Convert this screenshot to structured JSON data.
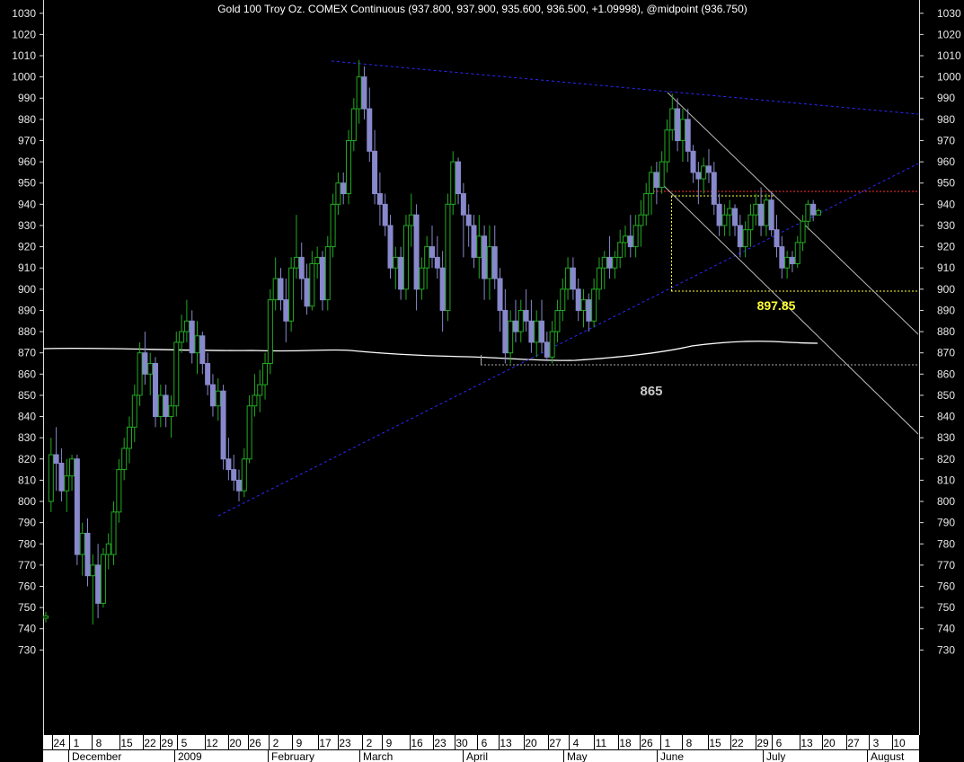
{
  "chart_data": {
    "type": "candlestick",
    "title": "Gold 100 Troy Oz. COMEX Continuous (937.800, 937.900, 935.600, 936.500, +1.09998), @midpoint (936.750)",
    "y_ticks": [
      1030,
      1020,
      1010,
      1000,
      990,
      980,
      970,
      960,
      950,
      940,
      930,
      920,
      910,
      900,
      890,
      880,
      870,
      860,
      850,
      840,
      830,
      820,
      810,
      800,
      790,
      780,
      770,
      760,
      750,
      740,
      730
    ],
    "ylim": [
      723,
      1035
    ],
    "day_labels": [
      "24",
      "1",
      "8",
      "15",
      "22",
      "29",
      "5",
      "12",
      "20",
      "26",
      "2",
      "9",
      "17",
      "23",
      "2",
      "9",
      "16",
      "23",
      "30",
      "6",
      "13",
      "20",
      "27",
      "4",
      "11",
      "18",
      "26",
      "1",
      "8",
      "15",
      "22",
      "29",
      "6",
      "13",
      "20",
      "27",
      "3",
      "10"
    ],
    "month_labels": [
      "December",
      "2009",
      "February",
      "March",
      "April",
      "May",
      "June",
      "July",
      "August"
    ],
    "annotations": [
      {
        "text": "897.85",
        "color": "#ffff33"
      },
      {
        "text": "865",
        "color": "#c8c8c8"
      }
    ],
    "colors": {
      "up": "#22aa22",
      "down": "#8888cc",
      "trend": "#2a2aff",
      "resistance": "#ff3030",
      "support_box": "#ffff33",
      "ma": "#ffffff",
      "channel": "#bbbbbb"
    },
    "candles": [
      {
        "o": 745,
        "h": 748,
        "l": 743,
        "c": 746
      },
      {
        "o": 800,
        "h": 830,
        "l": 795,
        "c": 822
      },
      {
        "o": 822,
        "h": 835,
        "l": 805,
        "c": 818
      },
      {
        "o": 818,
        "h": 825,
        "l": 800,
        "c": 805
      },
      {
        "o": 805,
        "h": 820,
        "l": 795,
        "c": 812
      },
      {
        "o": 812,
        "h": 822,
        "l": 805,
        "c": 820
      },
      {
        "o": 820,
        "h": 822,
        "l": 770,
        "c": 775
      },
      {
        "o": 775,
        "h": 790,
        "l": 765,
        "c": 785
      },
      {
        "o": 785,
        "h": 792,
        "l": 760,
        "c": 765
      },
      {
        "o": 765,
        "h": 775,
        "l": 742,
        "c": 770
      },
      {
        "o": 770,
        "h": 780,
        "l": 745,
        "c": 752
      },
      {
        "o": 752,
        "h": 778,
        "l": 750,
        "c": 775
      },
      {
        "o": 775,
        "h": 785,
        "l": 768,
        "c": 780
      },
      {
        "o": 775,
        "h": 800,
        "l": 770,
        "c": 795
      },
      {
        "o": 795,
        "h": 820,
        "l": 790,
        "c": 815
      },
      {
        "o": 815,
        "h": 830,
        "l": 810,
        "c": 825
      },
      {
        "o": 825,
        "h": 840,
        "l": 818,
        "c": 835
      },
      {
        "o": 835,
        "h": 855,
        "l": 828,
        "c": 850
      },
      {
        "o": 850,
        "h": 875,
        "l": 845,
        "c": 870
      },
      {
        "o": 870,
        "h": 880,
        "l": 855,
        "c": 860
      },
      {
        "o": 860,
        "h": 870,
        "l": 850,
        "c": 865
      },
      {
        "o": 865,
        "h": 868,
        "l": 835,
        "c": 840
      },
      {
        "o": 840,
        "h": 855,
        "l": 835,
        "c": 850
      },
      {
        "o": 850,
        "h": 855,
        "l": 835,
        "c": 840
      },
      {
        "o": 840,
        "h": 850,
        "l": 830,
        "c": 845
      },
      {
        "o": 845,
        "h": 880,
        "l": 840,
        "c": 875
      },
      {
        "o": 875,
        "h": 888,
        "l": 870,
        "c": 880
      },
      {
        "o": 880,
        "h": 895,
        "l": 875,
        "c": 885
      },
      {
        "o": 885,
        "h": 890,
        "l": 865,
        "c": 870
      },
      {
        "o": 870,
        "h": 885,
        "l": 860,
        "c": 878
      },
      {
        "o": 878,
        "h": 880,
        "l": 860,
        "c": 865
      },
      {
        "o": 865,
        "h": 870,
        "l": 850,
        "c": 855
      },
      {
        "o": 855,
        "h": 860,
        "l": 840,
        "c": 845
      },
      {
        "o": 845,
        "h": 858,
        "l": 838,
        "c": 852
      },
      {
        "o": 852,
        "h": 855,
        "l": 815,
        "c": 820
      },
      {
        "o": 820,
        "h": 830,
        "l": 810,
        "c": 815
      },
      {
        "o": 815,
        "h": 822,
        "l": 805,
        "c": 810
      },
      {
        "o": 810,
        "h": 815,
        "l": 800,
        "c": 805
      },
      {
        "o": 805,
        "h": 825,
        "l": 802,
        "c": 820
      },
      {
        "o": 820,
        "h": 850,
        "l": 818,
        "c": 845
      },
      {
        "o": 845,
        "h": 860,
        "l": 840,
        "c": 850
      },
      {
        "o": 850,
        "h": 862,
        "l": 842,
        "c": 855
      },
      {
        "o": 855,
        "h": 870,
        "l": 848,
        "c": 865
      },
      {
        "o": 865,
        "h": 900,
        "l": 860,
        "c": 895
      },
      {
        "o": 895,
        "h": 915,
        "l": 890,
        "c": 905
      },
      {
        "o": 905,
        "h": 910,
        "l": 890,
        "c": 895
      },
      {
        "o": 895,
        "h": 905,
        "l": 875,
        "c": 885
      },
      {
        "o": 885,
        "h": 915,
        "l": 880,
        "c": 910
      },
      {
        "o": 910,
        "h": 935,
        "l": 905,
        "c": 915
      },
      {
        "o": 915,
        "h": 922,
        "l": 895,
        "c": 905
      },
      {
        "o": 905,
        "h": 912,
        "l": 888,
        "c": 892
      },
      {
        "o": 892,
        "h": 918,
        "l": 890,
        "c": 912
      },
      {
        "o": 912,
        "h": 920,
        "l": 905,
        "c": 915
      },
      {
        "o": 915,
        "h": 918,
        "l": 890,
        "c": 895
      },
      {
        "o": 895,
        "h": 925,
        "l": 890,
        "c": 920
      },
      {
        "o": 920,
        "h": 945,
        "l": 915,
        "c": 940
      },
      {
        "o": 940,
        "h": 955,
        "l": 935,
        "c": 950
      },
      {
        "o": 950,
        "h": 955,
        "l": 940,
        "c": 945
      },
      {
        "o": 945,
        "h": 975,
        "l": 940,
        "c": 970
      },
      {
        "o": 970,
        "h": 990,
        "l": 965,
        "c": 985
      },
      {
        "o": 985,
        "h": 1008,
        "l": 978,
        "c": 1000
      },
      {
        "o": 1000,
        "h": 1005,
        "l": 980,
        "c": 985
      },
      {
        "o": 985,
        "h": 995,
        "l": 960,
        "c": 965
      },
      {
        "o": 965,
        "h": 975,
        "l": 940,
        "c": 945
      },
      {
        "o": 945,
        "h": 955,
        "l": 930,
        "c": 940
      },
      {
        "o": 940,
        "h": 945,
        "l": 925,
        "c": 930
      },
      {
        "o": 930,
        "h": 935,
        "l": 905,
        "c": 910
      },
      {
        "o": 910,
        "h": 920,
        "l": 900,
        "c": 915
      },
      {
        "o": 915,
        "h": 920,
        "l": 895,
        "c": 900
      },
      {
        "o": 900,
        "h": 935,
        "l": 895,
        "c": 930
      },
      {
        "o": 930,
        "h": 945,
        "l": 920,
        "c": 935
      },
      {
        "o": 935,
        "h": 940,
        "l": 890,
        "c": 900
      },
      {
        "o": 900,
        "h": 915,
        "l": 895,
        "c": 910
      },
      {
        "o": 910,
        "h": 925,
        "l": 900,
        "c": 920
      },
      {
        "o": 920,
        "h": 930,
        "l": 910,
        "c": 915
      },
      {
        "o": 915,
        "h": 925,
        "l": 905,
        "c": 910
      },
      {
        "o": 910,
        "h": 918,
        "l": 880,
        "c": 890
      },
      {
        "o": 890,
        "h": 945,
        "l": 885,
        "c": 940
      },
      {
        "o": 940,
        "h": 965,
        "l": 935,
        "c": 960
      },
      {
        "o": 960,
        "h": 962,
        "l": 940,
        "c": 945
      },
      {
        "o": 945,
        "h": 950,
        "l": 915,
        "c": 935
      },
      {
        "o": 935,
        "h": 940,
        "l": 920,
        "c": 930
      },
      {
        "o": 930,
        "h": 935,
        "l": 910,
        "c": 915
      },
      {
        "o": 915,
        "h": 935,
        "l": 905,
        "c": 925
      },
      {
        "o": 925,
        "h": 930,
        "l": 895,
        "c": 905
      },
      {
        "o": 905,
        "h": 930,
        "l": 895,
        "c": 920
      },
      {
        "o": 920,
        "h": 930,
        "l": 900,
        "c": 905
      },
      {
        "o": 905,
        "h": 910,
        "l": 880,
        "c": 890
      },
      {
        "o": 890,
        "h": 900,
        "l": 865,
        "c": 870
      },
      {
        "o": 870,
        "h": 890,
        "l": 865,
        "c": 885
      },
      {
        "o": 885,
        "h": 895,
        "l": 875,
        "c": 880
      },
      {
        "o": 880,
        "h": 895,
        "l": 875,
        "c": 890
      },
      {
        "o": 890,
        "h": 900,
        "l": 880,
        "c": 885
      },
      {
        "o": 885,
        "h": 895,
        "l": 870,
        "c": 875
      },
      {
        "o": 875,
        "h": 890,
        "l": 868,
        "c": 885
      },
      {
        "o": 885,
        "h": 895,
        "l": 870,
        "c": 875
      },
      {
        "o": 875,
        "h": 880,
        "l": 866,
        "c": 868
      },
      {
        "o": 868,
        "h": 885,
        "l": 865,
        "c": 880
      },
      {
        "o": 880,
        "h": 895,
        "l": 875,
        "c": 890
      },
      {
        "o": 890,
        "h": 905,
        "l": 885,
        "c": 900
      },
      {
        "o": 900,
        "h": 915,
        "l": 895,
        "c": 910
      },
      {
        "o": 910,
        "h": 915,
        "l": 895,
        "c": 900
      },
      {
        "o": 900,
        "h": 905,
        "l": 885,
        "c": 890
      },
      {
        "o": 890,
        "h": 900,
        "l": 882,
        "c": 895
      },
      {
        "o": 895,
        "h": 898,
        "l": 880,
        "c": 885
      },
      {
        "o": 885,
        "h": 905,
        "l": 882,
        "c": 900
      },
      {
        "o": 900,
        "h": 915,
        "l": 895,
        "c": 910
      },
      {
        "o": 910,
        "h": 918,
        "l": 900,
        "c": 915
      },
      {
        "o": 915,
        "h": 925,
        "l": 905,
        "c": 910
      },
      {
        "o": 910,
        "h": 918,
        "l": 905,
        "c": 915
      },
      {
        "o": 915,
        "h": 928,
        "l": 910,
        "c": 922
      },
      {
        "o": 922,
        "h": 930,
        "l": 915,
        "c": 925
      },
      {
        "o": 925,
        "h": 935,
        "l": 915,
        "c": 920
      },
      {
        "o": 920,
        "h": 935,
        "l": 915,
        "c": 930
      },
      {
        "o": 930,
        "h": 942,
        "l": 920,
        "c": 935
      },
      {
        "o": 935,
        "h": 950,
        "l": 930,
        "c": 945
      },
      {
        "o": 945,
        "h": 958,
        "l": 935,
        "c": 955
      },
      {
        "o": 955,
        "h": 960,
        "l": 940,
        "c": 948
      },
      {
        "o": 948,
        "h": 965,
        "l": 945,
        "c": 960
      },
      {
        "o": 960,
        "h": 980,
        "l": 955,
        "c": 975
      },
      {
        "o": 975,
        "h": 992,
        "l": 970,
        "c": 985
      },
      {
        "o": 985,
        "h": 990,
        "l": 965,
        "c": 970
      },
      {
        "o": 970,
        "h": 985,
        "l": 960,
        "c": 980
      },
      {
        "o": 980,
        "h": 985,
        "l": 960,
        "c": 965
      },
      {
        "o": 965,
        "h": 968,
        "l": 950,
        "c": 955
      },
      {
        "o": 955,
        "h": 960,
        "l": 940,
        "c": 952
      },
      {
        "o": 952,
        "h": 962,
        "l": 945,
        "c": 958
      },
      {
        "o": 958,
        "h": 966,
        "l": 950,
        "c": 955
      },
      {
        "o": 955,
        "h": 960,
        "l": 935,
        "c": 940
      },
      {
        "o": 940,
        "h": 945,
        "l": 925,
        "c": 930
      },
      {
        "o": 930,
        "h": 940,
        "l": 925,
        "c": 935
      },
      {
        "o": 935,
        "h": 942,
        "l": 925,
        "c": 938
      },
      {
        "o": 938,
        "h": 940,
        "l": 925,
        "c": 930
      },
      {
        "o": 930,
        "h": 935,
        "l": 915,
        "c": 920
      },
      {
        "o": 920,
        "h": 932,
        "l": 915,
        "c": 928
      },
      {
        "o": 928,
        "h": 940,
        "l": 920,
        "c": 935
      },
      {
        "o": 935,
        "h": 945,
        "l": 930,
        "c": 940
      },
      {
        "o": 940,
        "h": 948,
        "l": 925,
        "c": 930
      },
      {
        "o": 930,
        "h": 945,
        "l": 925,
        "c": 942
      },
      {
        "o": 942,
        "h": 946,
        "l": 925,
        "c": 928
      },
      {
        "o": 928,
        "h": 935,
        "l": 915,
        "c": 920
      },
      {
        "o": 920,
        "h": 925,
        "l": 905,
        "c": 910
      },
      {
        "o": 910,
        "h": 918,
        "l": 905,
        "c": 915
      },
      {
        "o": 915,
        "h": 918,
        "l": 908,
        "c": 912
      },
      {
        "o": 912,
        "h": 925,
        "l": 910,
        "c": 922
      },
      {
        "o": 922,
        "h": 935,
        "l": 918,
        "c": 932
      },
      {
        "o": 932,
        "h": 942,
        "l": 928,
        "c": 940
      },
      {
        "o": 940,
        "h": 942,
        "l": 932,
        "c": 935
      },
      {
        "o": 935,
        "h": 938,
        "l": 935,
        "c": 937
      }
    ]
  }
}
